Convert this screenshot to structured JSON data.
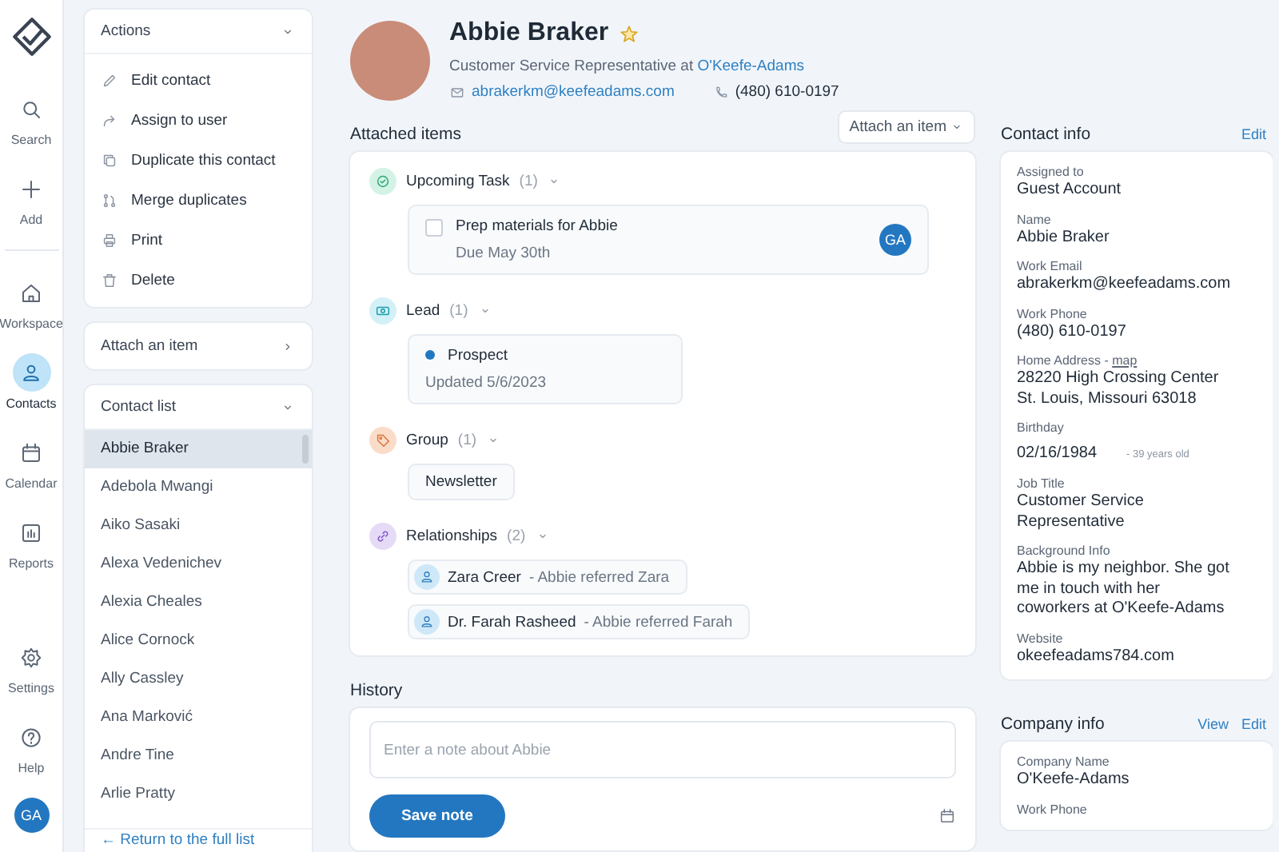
{
  "nav": {
    "top": [
      {
        "kind": "search",
        "label": "Search",
        "selected": false
      },
      {
        "kind": "add",
        "label": "Add",
        "selected": false
      }
    ],
    "main": [
      {
        "kind": "home",
        "label": "Workspace",
        "selected": false
      },
      {
        "kind": "person",
        "label": "Contacts",
        "selected": true
      },
      {
        "kind": "calendar",
        "label": "Calendar",
        "selected": false
      },
      {
        "kind": "chart",
        "label": "Reports",
        "selected": false
      }
    ],
    "bottom": [
      {
        "kind": "gear",
        "label": "Settings",
        "selected": false
      },
      {
        "kind": "help",
        "label": "Help",
        "selected": false
      }
    ],
    "avatar": "GA"
  },
  "actions": {
    "title": "Actions",
    "items": [
      {
        "kind": "pencil",
        "label": "Edit contact"
      },
      {
        "kind": "share",
        "label": "Assign to user"
      },
      {
        "kind": "copy",
        "label": "Duplicate this contact"
      },
      {
        "kind": "merge",
        "label": "Merge duplicates"
      },
      {
        "kind": "print",
        "label": "Print"
      },
      {
        "kind": "trash",
        "label": "Delete"
      }
    ]
  },
  "attach_panel": {
    "title": "Attach an item"
  },
  "contact_list": {
    "title": "Contact list",
    "items": [
      {
        "label": "Abbie Braker",
        "selected": true
      },
      {
        "label": "Adebola Mwangi",
        "selected": false
      },
      {
        "label": "Aiko Sasaki",
        "selected": false
      },
      {
        "label": "Alexa Vedenichev",
        "selected": false
      },
      {
        "label": "Alexia Cheales",
        "selected": false
      },
      {
        "label": "Alice Cornock",
        "selected": false
      },
      {
        "label": "Ally Cassley",
        "selected": false
      },
      {
        "label": "Ana Marković",
        "selected": false
      },
      {
        "label": "Andre Tine",
        "selected": false
      },
      {
        "label": "Arlie Pratty",
        "selected": false
      }
    ],
    "footer": "← Return to the full list"
  },
  "profile": {
    "name": "Abbie Braker",
    "starred": true,
    "role": "Customer Service Representative at",
    "company": "O'Keefe-Adams",
    "email": "abrakerkm@keefeadams.com",
    "phone": "(480) 610-0197"
  },
  "attached": {
    "title": "Attached items",
    "button": "Attach an item",
    "sections": [
      {
        "kind": "task",
        "title": "Upcoming Task",
        "count": "(1)",
        "items": [
          {
            "title": "Prep materials for Abbie",
            "due": "Due May 30th",
            "checked": false,
            "assignee": "GA"
          }
        ]
      },
      {
        "kind": "lead",
        "title": "Lead",
        "count": "(1)",
        "items": [
          {
            "title": "Prospect",
            "updated": "Updated 5/6/2023"
          }
        ]
      },
      {
        "kind": "group",
        "title": "Group",
        "count": "(1)",
        "items": [
          {
            "title": "Newsletter"
          }
        ]
      },
      {
        "kind": "relationships",
        "title": "Relationships",
        "count": "(2)",
        "items": [
          {
            "title": "Zara Creer",
            "note": "- Abbie referred Zara"
          },
          {
            "title": "Dr. Farah Rasheed",
            "note": "- Abbie referred Farah"
          }
        ]
      }
    ]
  },
  "history": {
    "title": "History",
    "placeholder": "Enter a note about Abbie",
    "button": "Save note"
  },
  "contact_info": {
    "title": "Contact info",
    "actions": [
      "Edit"
    ],
    "fields": [
      {
        "label": "Assigned to",
        "value": "Guest Account"
      },
      {
        "label": "Name",
        "value": "Abbie Braker"
      },
      {
        "label": "Work Email",
        "value": "abrakerkm@keefeadams.com"
      },
      {
        "label": "Work Phone",
        "value": "(480) 610-0197"
      },
      {
        "label": "Home Address -",
        "link": "map",
        "value": "28220 High Crossing Center St. Louis, Missouri 63018"
      },
      {
        "label": "Birthday",
        "value": "02/16/1984",
        "note": "- 39 years old"
      },
      {
        "label": "Job Title",
        "value": "Customer Service Representative"
      },
      {
        "label": "Background Info",
        "value": "Abbie is my neighbor. She got me in touch with her coworkers at O'Keefe-Adams"
      },
      {
        "label": "Website",
        "value": "okeefeadams784.com"
      }
    ]
  },
  "company_info": {
    "title": "Company info",
    "actions": [
      "View",
      "Edit"
    ],
    "fields": [
      {
        "label": "Company Name",
        "value": "O'Keefe-Adams"
      },
      {
        "label": "Work Phone"
      }
    ]
  }
}
